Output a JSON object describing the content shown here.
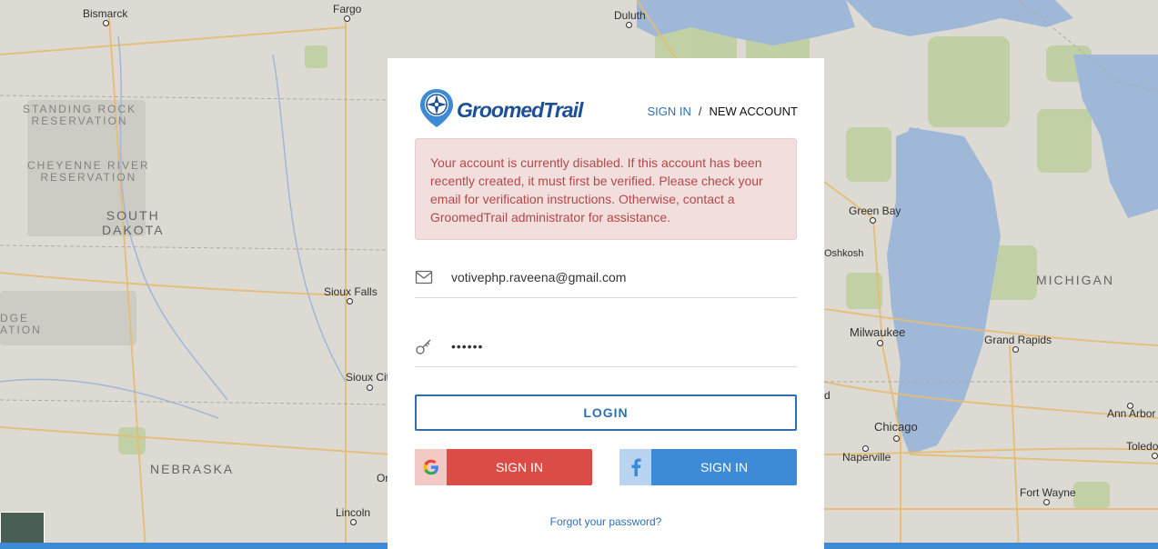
{
  "map": {
    "labels": {
      "bismarck": "Bismarck",
      "fargo": "Fargo",
      "duluth": "Duluth",
      "standing_rock": "STANDING ROCK\nRESERVATION",
      "cheyenne_river": "CHEYENNE RIVER\nRESERVATION",
      "south_dakota": "SOUTH\nDAKOTA",
      "edge_fragment": "DGE\nATION",
      "sioux_falls": "Sioux Falls",
      "sioux_city": "Sioux Cit",
      "nebraska": "NEBRASKA",
      "lincoln": "Lincoln",
      "omaha_fragment": "Or",
      "green_bay": "Green Bay",
      "oshkosh": "Oshkosh",
      "milwaukee": "Milwaukee",
      "michigan": "MICHIGAN",
      "grand_rapids": "Grand Rapids",
      "chicago": "Chicago",
      "naperville": "Naperville",
      "ann_arbor": "Ann Arbor",
      "toledo": "Toledo",
      "fort_wayne": "Fort Wayne",
      "d_fragment": "d"
    },
    "colors": {
      "land": "#e8e6df",
      "water": "#a9c2e4",
      "parks": "#c8d9a6",
      "roads": "#f2c77b"
    }
  },
  "card": {
    "logo_text": "GroomedTrail",
    "nav": {
      "sign_in": "SIGN IN",
      "separator": "/",
      "new_account": "NEW ACCOUNT"
    },
    "alert_message": "Your account is currently disabled. If this account has been recently created, it must first be verified. Please check your email for verification instructions. Otherwise, contact a GroomedTrail administrator for assistance.",
    "email": {
      "value": "votivephp.raveena@gmail.com",
      "icon": "envelope-icon"
    },
    "password": {
      "value": "••••••",
      "icon": "key-icon"
    },
    "login_label": "LOGIN",
    "google_label": "SIGN IN",
    "facebook_label": "SIGN IN",
    "forgot_label": "Forgot your password?",
    "colors": {
      "primary": "#2e6fb4",
      "google": "#db4c47",
      "facebook": "#3d8ad6",
      "alert_bg": "#f3dede",
      "alert_text": "#b04a4a"
    }
  }
}
